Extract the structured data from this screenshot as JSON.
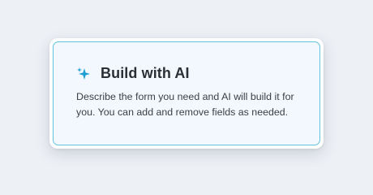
{
  "card": {
    "icon": "sparkles-icon",
    "title": "Build with AI",
    "description": "Describe the form you need and AI will build it for you. You can add and remove fields as needed."
  },
  "colors": {
    "background": "#edf0f5",
    "card_fill": "#f2f8fd",
    "card_border": "#5fc4dc",
    "sparkle": "#1e9fd4",
    "title": "#2a2e35",
    "text": "#3a3f46"
  }
}
